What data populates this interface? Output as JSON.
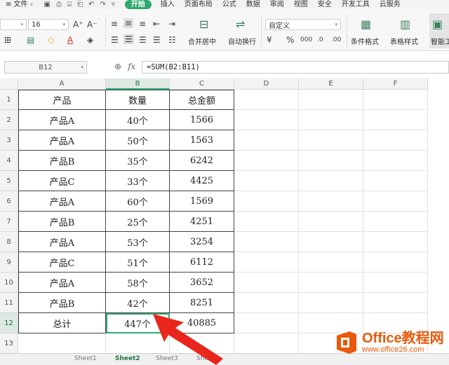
{
  "menu": {
    "file": "文件",
    "tabs": [
      "开始",
      "插入",
      "页面布局",
      "公式",
      "数据",
      "审阅",
      "视图",
      "安全",
      "开发工具",
      "云服务"
    ],
    "active_tab": "开始"
  },
  "ribbon": {
    "font_size": "16",
    "merge_center": "合并居中",
    "auto_wrap": "自动换行",
    "number_format": "自定义",
    "conditional_format": "条件格式",
    "table_style": "表格样式",
    "smart_toolbox": "智能工具箱",
    "percent": "%",
    "thousands": "000"
  },
  "formula_bar": {
    "cell_ref": "B12",
    "fx": "fx",
    "formula": "=SUM(B2:B11)"
  },
  "grid": {
    "columns": [
      "A",
      "B",
      "C",
      "D",
      "E",
      "F"
    ],
    "rows": [
      "1",
      "2",
      "3",
      "4",
      "5",
      "6",
      "7",
      "8",
      "9",
      "10",
      "11",
      "12",
      "13"
    ],
    "headers": [
      "产品",
      "数量",
      "总金额"
    ],
    "data": [
      [
        "产品A",
        "40个",
        "1566"
      ],
      [
        "产品A",
        "50个",
        "1563"
      ],
      [
        "产品B",
        "35个",
        "6242"
      ],
      [
        "产品C",
        "33个",
        "4425"
      ],
      [
        "产品A",
        "60个",
        "1569"
      ],
      [
        "产品B",
        "25个",
        "4251"
      ],
      [
        "产品A",
        "53个",
        "3254"
      ],
      [
        "产品C",
        "51个",
        "6112"
      ],
      [
        "产品A",
        "58个",
        "3652"
      ],
      [
        "产品B",
        "42个",
        "8251"
      ]
    ],
    "total": [
      "总计",
      "447个",
      "40885"
    ]
  },
  "sheets": [
    "Sheet1",
    "Sheet2",
    "Sheet3",
    "Sheet4"
  ],
  "active_sheet": "Sheet2",
  "watermark": {
    "brand": "Office教程网",
    "url": "www.office26.com"
  },
  "colors": {
    "accent": "#2fa86d",
    "arrow": "#e8261c",
    "watermark": "#e8590c"
  }
}
